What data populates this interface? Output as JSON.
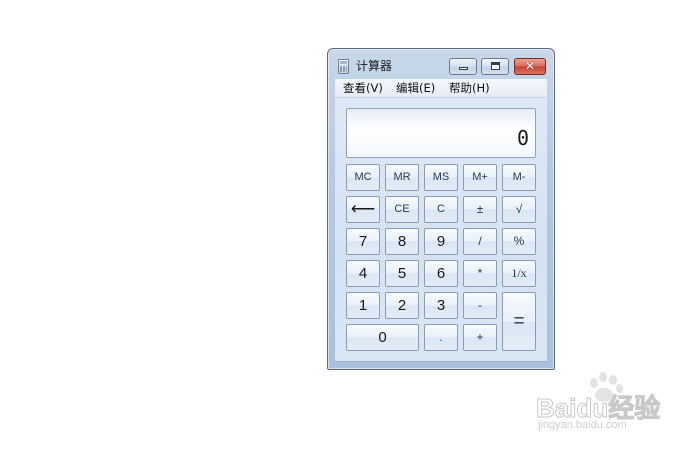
{
  "window": {
    "title": "计算器",
    "close_symbol": "✕"
  },
  "menu": {
    "view": "查看(V)",
    "edit": "编辑(E)",
    "help": "帮助(H)"
  },
  "display": {
    "value": "0"
  },
  "keys": {
    "mc": "MC",
    "mr": "MR",
    "ms": "MS",
    "mplus": "M+",
    "mminus": "M-",
    "backspace": "⟵",
    "ce": "CE",
    "c": "C",
    "plusminus": "±",
    "sqrt": "√",
    "d7": "7",
    "d8": "8",
    "d9": "9",
    "divide": "/",
    "percent": "%",
    "d4": "4",
    "d5": "5",
    "d6": "6",
    "multiply": "*",
    "reciprocal": "1/x",
    "d1": "1",
    "d2": "2",
    "d3": "3",
    "minus": "-",
    "equals": "=",
    "d0": "0",
    "decimal": ".",
    "plus": "+"
  },
  "watermark": {
    "brand": "Baidu经验",
    "url": "jingyan.baidu.com"
  }
}
